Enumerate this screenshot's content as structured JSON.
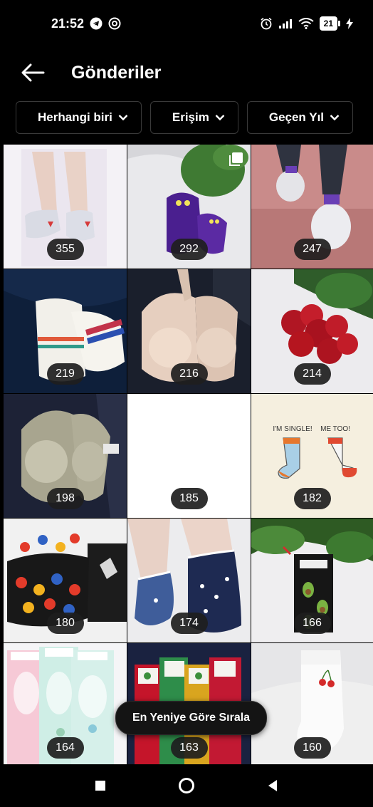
{
  "status_bar": {
    "time": "21:52",
    "battery": "21"
  },
  "header": {
    "title": "Gönderiler"
  },
  "filters": [
    {
      "label": "Herhangi biri"
    },
    {
      "label": "Erişim"
    },
    {
      "label": "Geçen Yıl"
    }
  ],
  "posts": [
    {
      "count": "355"
    },
    {
      "count": "292"
    },
    {
      "count": "247"
    },
    {
      "count": "219"
    },
    {
      "count": "216"
    },
    {
      "count": "214"
    },
    {
      "count": "198"
    },
    {
      "count": "185"
    },
    {
      "count": "182"
    },
    {
      "count": "180"
    },
    {
      "count": "174"
    },
    {
      "count": "166"
    },
    {
      "count": "164"
    },
    {
      "count": "163"
    },
    {
      "count": "160"
    }
  ],
  "thumbnail_texts": {
    "single": "I'M SINGLE!",
    "metoo": "ME TOO!"
  },
  "sort_button": {
    "label": "En Yeniye Göre Sırala"
  },
  "colors": {
    "background": "#000000",
    "text": "#ffffff",
    "chip_border": "#3a3a3a",
    "badge": "#1e1e1e"
  }
}
